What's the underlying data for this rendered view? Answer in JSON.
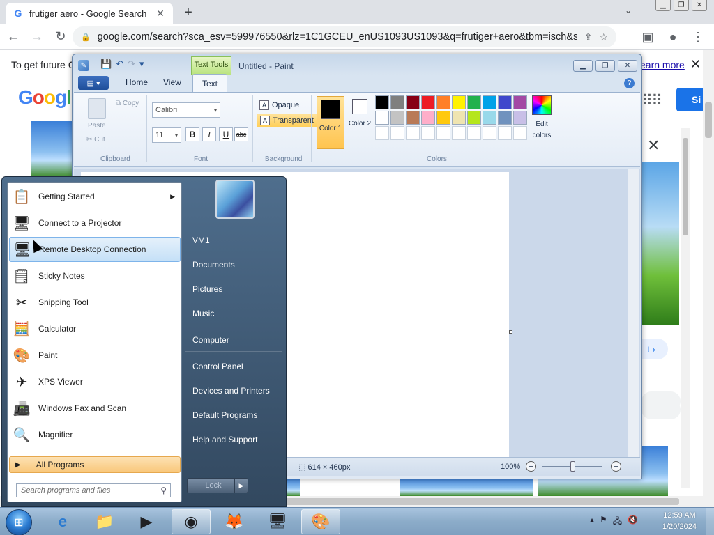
{
  "browser": {
    "tab_title": "frutiger aero - Google Search",
    "tab_favicon": "G",
    "url": "google.com/search?sca_esv=599976550&rlz=1C1GCEU_enUS1093US1093&q=frutiger+aero&tbm=isch&sour...",
    "notice_text": "To get future G",
    "notice_link": "earn more",
    "logo": [
      "G",
      "o",
      "o",
      "g",
      "l"
    ],
    "signin": "Si",
    "next_label": "t ›"
  },
  "paint": {
    "title": "Untitled - Paint",
    "contextual_tab": "Text Tools",
    "tabs": [
      "Home",
      "View",
      "Text"
    ],
    "clipboard": {
      "paste": "Paste",
      "copy": "Copy",
      "cut": "Cut",
      "label": "Clipboard"
    },
    "font": {
      "family": "Calibri",
      "size": "11",
      "bold": "B",
      "italic": "I",
      "underline": "U",
      "strike": "abc",
      "label": "Font"
    },
    "background": {
      "opaque": "Opaque",
      "transparent": "Transparent",
      "label": "Background"
    },
    "colors": {
      "color1_label": "Color 1",
      "color2_label": "Color 2",
      "edit_label": "Edit colors",
      "label": "Colors",
      "color1": "#000000",
      "color2": "#ffffff",
      "palette": [
        "#000000",
        "#7f7f7f",
        "#880015",
        "#ed1c24",
        "#ff7f27",
        "#fff200",
        "#22b14c",
        "#00a2e8",
        "#3f48cc",
        "#a349a4",
        "#ffffff",
        "#c3c3c3",
        "#b97a57",
        "#ffaec9",
        "#ffc90e",
        "#efe4b0",
        "#b5e61d",
        "#99d9ea",
        "#7092be",
        "#c8bfe7",
        "#ffffff",
        "#ffffff",
        "#ffffff",
        "#ffffff",
        "#ffffff",
        "#ffffff",
        "#ffffff",
        "#ffffff",
        "#ffffff",
        "#ffffff"
      ]
    },
    "status": {
      "canvas_size": "614 × 460px",
      "zoom": "100%"
    }
  },
  "start_menu": {
    "programs": [
      {
        "label": "Getting Started",
        "icon": "getting-started-icon",
        "glyph": "📋",
        "submenu": true
      },
      {
        "label": "Connect to a Projector",
        "icon": "projector-icon",
        "glyph": "🖥",
        "submenu": false
      },
      {
        "label": "Remote Desktop Connection",
        "icon": "remote-desktop-icon",
        "glyph": "🖥",
        "submenu": false
      },
      {
        "label": "Sticky Notes",
        "icon": "sticky-notes-icon",
        "glyph": "🗒",
        "submenu": false
      },
      {
        "label": "Snipping Tool",
        "icon": "scissors-icon",
        "glyph": "✂",
        "submenu": false
      },
      {
        "label": "Calculator",
        "icon": "calculator-icon",
        "glyph": "🧮",
        "submenu": false
      },
      {
        "label": "Paint",
        "icon": "paint-palette-icon",
        "glyph": "🎨",
        "submenu": false
      },
      {
        "label": "XPS Viewer",
        "icon": "xps-viewer-icon",
        "glyph": "✈",
        "submenu": false
      },
      {
        "label": "Windows Fax and Scan",
        "icon": "fax-icon",
        "glyph": "📠",
        "submenu": false
      },
      {
        "label": "Magnifier",
        "icon": "magnifier-icon",
        "glyph": "🔍",
        "submenu": false
      }
    ],
    "all_programs": "All Programs",
    "search_placeholder": "Search programs and files",
    "right_items": [
      "VM1",
      "Documents",
      "Pictures",
      "Music",
      "Computer",
      "Control Panel",
      "Devices and Printers",
      "Default Programs",
      "Help and Support"
    ],
    "lock": "Lock"
  },
  "taskbar": {
    "time": "12:59 AM",
    "date": "1/20/2024",
    "apps": [
      "internet-explorer-icon",
      "file-explorer-icon",
      "media-player-icon",
      "chrome-icon",
      "firefox-icon",
      "remote-desktop-icon",
      "paint-palette-icon"
    ]
  }
}
